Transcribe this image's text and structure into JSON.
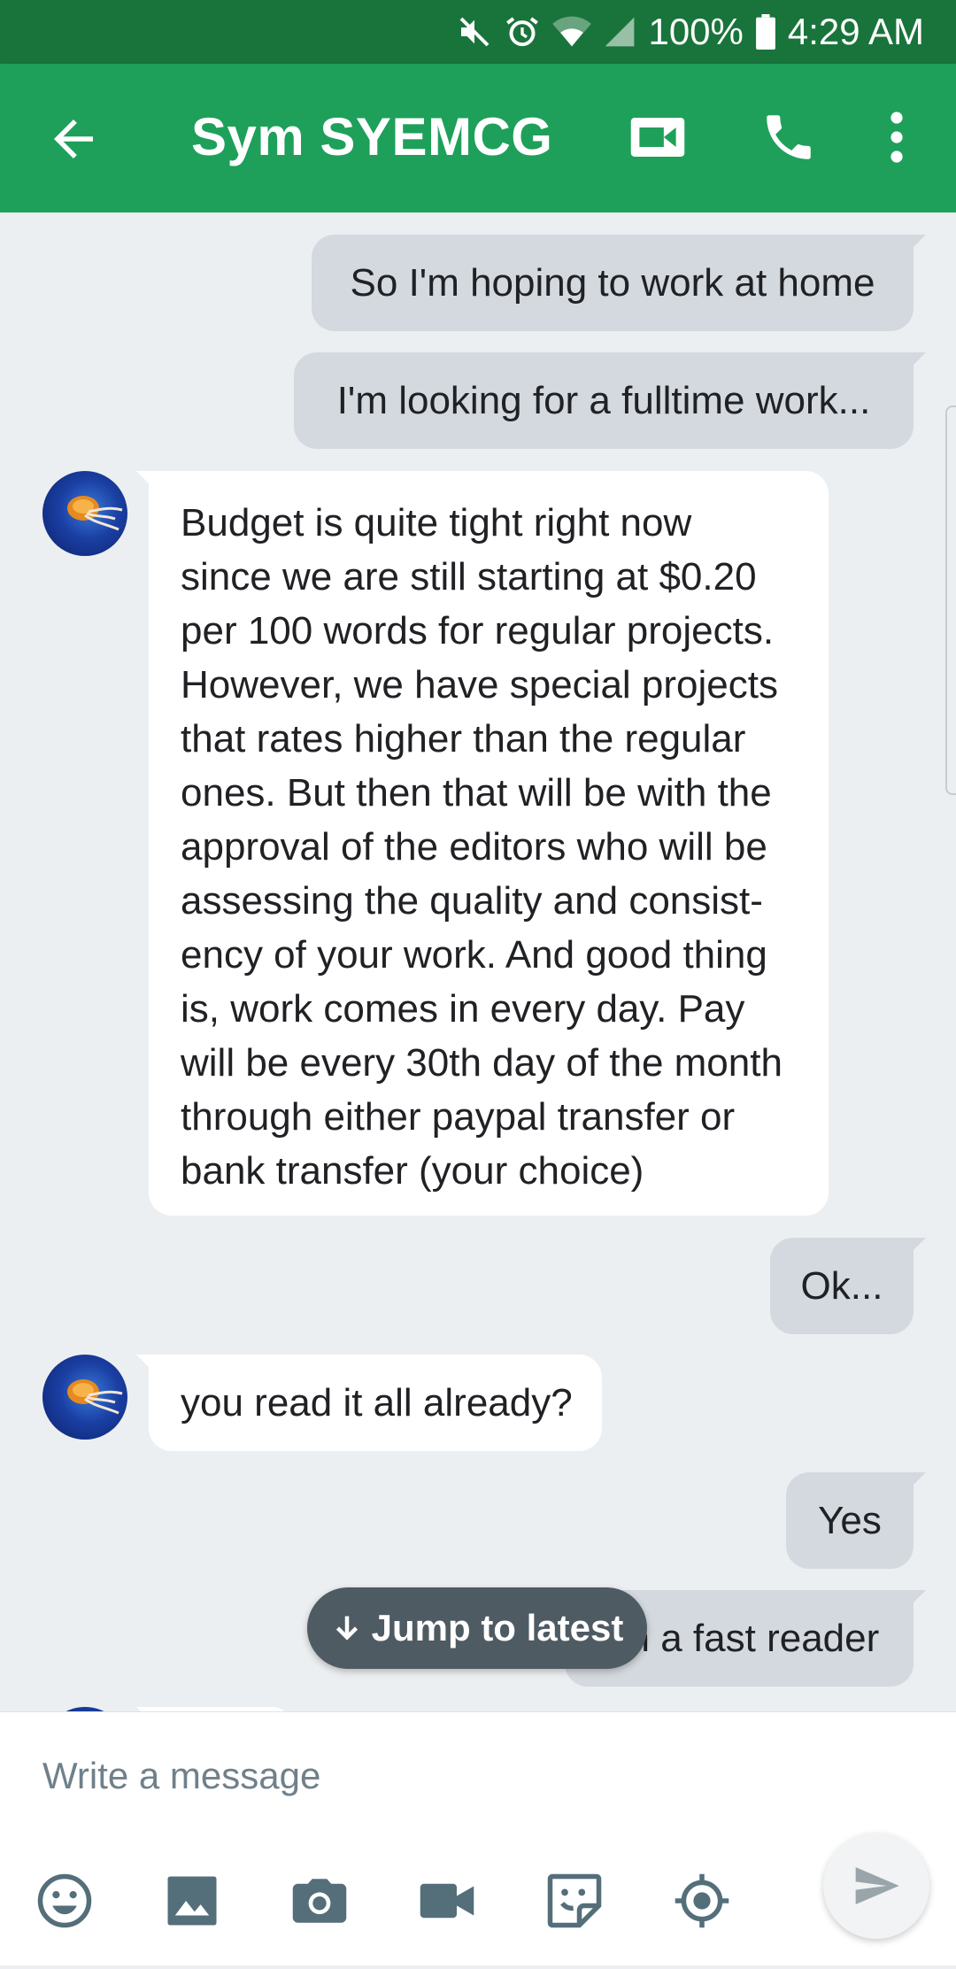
{
  "status_bar": {
    "battery": "100%",
    "time": "4:29 AM"
  },
  "header": {
    "title": "Sym SYEMCG"
  },
  "messages": {
    "m1": "So I'm hoping to work at home",
    "m2": "I'm looking for a fulltime work...",
    "m3": "Budget is quite tight right now\nsince we are still starting at $0.20\nper 100 words for regular projects.\nHowever, we have special projects\nthat rates higher than the regular\nones. But then that will be with the\napproval of the editors who will be\nassessing the quality and consist-\nency of your work. And good thing\nis, work comes in every day. Pay\nwill be every 30th day of the month\nthrough either paypal transfer or\nbank transfer (your choice)",
    "m4": "Ok...",
    "m5": "you read it all already?",
    "m6": "Yes",
    "m7": "I'm a fast reader"
  },
  "jump_button": {
    "label": "Jump to latest"
  },
  "composer": {
    "placeholder": "Write a message"
  },
  "icons": [
    "back-arrow-icon",
    "video-call-icon",
    "phone-icon",
    "more-vert-icon",
    "emoji-icon",
    "image-icon",
    "camera-icon",
    "video-icon",
    "sticker-icon",
    "location-icon",
    "send-icon"
  ],
  "colors": {
    "status_bar": "#19743b",
    "app_bar": "#1ea05a",
    "outgoing_bubble": "#d3d9de",
    "incoming_bubble": "#ffffff",
    "background": "#eceff1",
    "jump_button": "#4f5b62"
  }
}
